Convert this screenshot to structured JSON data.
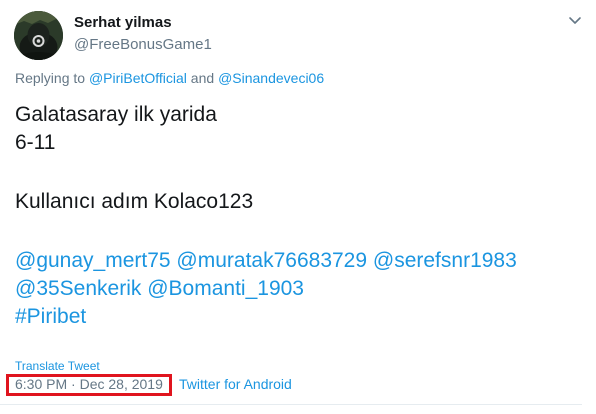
{
  "author": {
    "name": "Serhat yilmas",
    "handle": "@FreeBonusGame1"
  },
  "reply": {
    "prefix": "Replying to ",
    "user1": "@PiriBetOfficial",
    "joiner": " and ",
    "user2": "@Sinandeveci06"
  },
  "tweet": {
    "line1": "Galatasaray ilk yarida",
    "line2": "6-11",
    "line3": "Kullanıcı adım Kolaco123",
    "mentions_row1": [
      "@gunay_mert75",
      "@muratak76683729",
      "@serefsnr1983"
    ],
    "mentions_row2": [
      "@35Senkerik",
      "@Bomanti_1903"
    ],
    "hashtag": "#Piribet"
  },
  "actions": {
    "translate": "Translate Tweet",
    "timestamp": "6:30 PM · Dec 28, 2019",
    "source": "Twitter for Android"
  },
  "icons": {
    "menu": "chevron-down-icon"
  },
  "colors": {
    "link": "#1b95e0",
    "muted": "#657786",
    "highlight": "#e0141e"
  }
}
